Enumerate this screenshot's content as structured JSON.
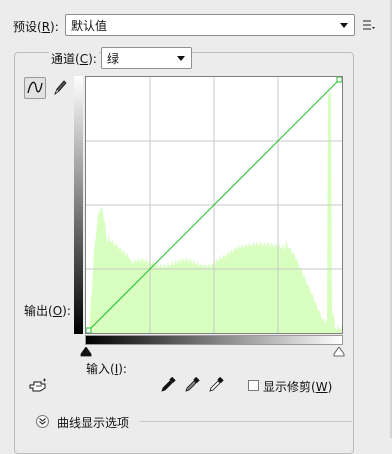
{
  "preset": {
    "label": "预设(",
    "shortcut": "R",
    "label_suffix": "):",
    "value": "默认值"
  },
  "channel": {
    "label": "通道(",
    "shortcut": "C",
    "label_suffix": "):",
    "value": "绿"
  },
  "output": {
    "label": "输出(",
    "shortcut": "O",
    "label_suffix": "):"
  },
  "input": {
    "label": "输入(",
    "shortcut": "I",
    "label_suffix": "):"
  },
  "show_clipping": {
    "label": "显示修剪(",
    "shortcut": "W",
    "label_suffix": ")",
    "checked": false
  },
  "curve_options": {
    "label": "曲线显示选项"
  },
  "icons": {
    "curve_tool": "curve-icon",
    "pencil_tool": "pencil-icon",
    "panel_menu": "panel-menu-icon",
    "target_adjust": "target-adjust-hand-icon",
    "black_eyedropper": "black-point-eyedropper-icon",
    "gray_eyedropper": "gray-point-eyedropper-icon",
    "white_eyedropper": "white-point-eyedropper-icon",
    "expand_options": "expand-chevron-icon"
  },
  "colors": {
    "histogram_fill": "#d8ffc0",
    "curve_line": "#22c02a",
    "grid_line": "#c8c8c8"
  }
}
